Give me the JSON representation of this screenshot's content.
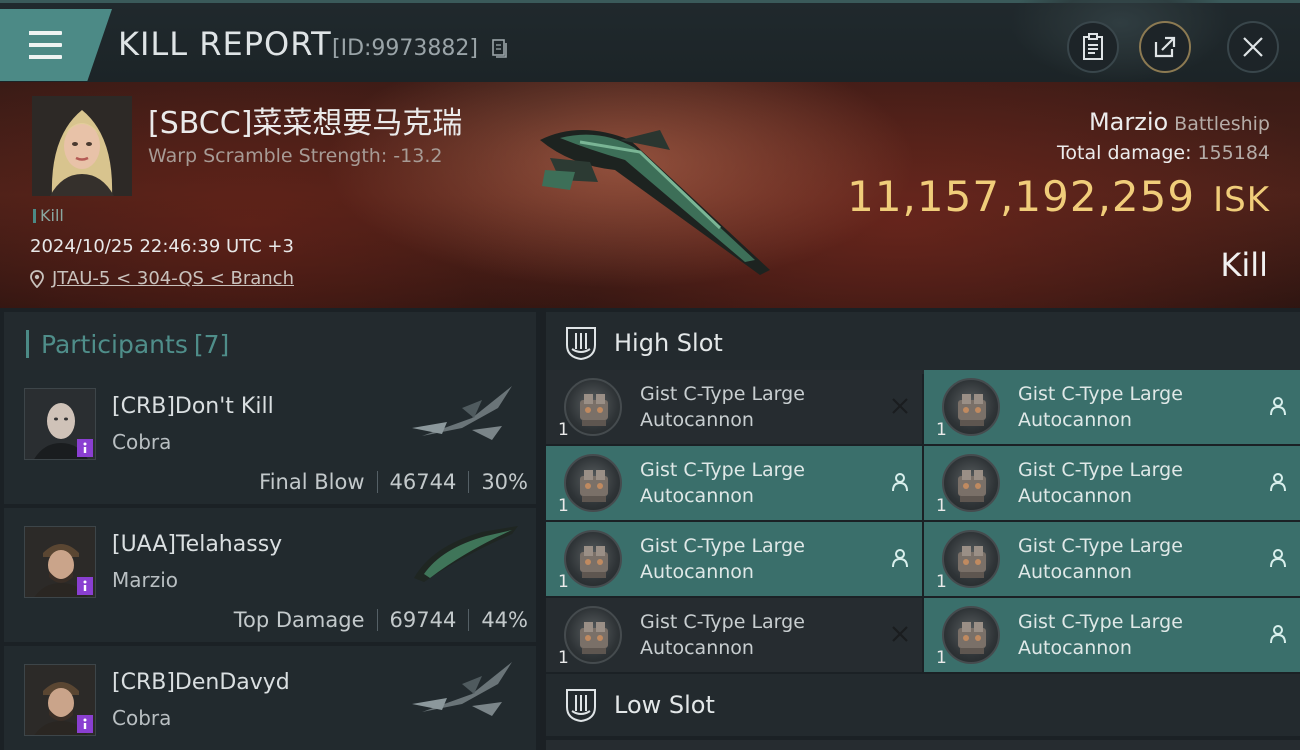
{
  "header": {
    "title": "KILL REPORT",
    "report_id": "[ID:9973882]"
  },
  "victim": {
    "pilot_name": "[SBCC]菜菜想要马克瑞",
    "warp_scramble": "Warp Scramble Strength: -13.2",
    "tag": "Kill",
    "timestamp": "2024/10/25 22:46:39 UTC +3",
    "location": "JTAU-5 < 304-QS < Branch",
    "ship_name": "Marzio",
    "ship_class": "Battleship",
    "total_damage_label": "Total damage:",
    "total_damage": "155184",
    "isk_value": "11,157,192,259",
    "isk_unit": "ISK",
    "result": "Kill"
  },
  "participants": {
    "label": "Participants",
    "count": "[7]",
    "rows": [
      {
        "name": "[CRB]Don't Kill",
        "ship": "Cobra",
        "role": "Final Blow",
        "damage": "46744",
        "percent": "30%"
      },
      {
        "name": "[UAA]Telahassy",
        "ship": "Marzio",
        "role": "Top Damage",
        "damage": "69744",
        "percent": "44%"
      },
      {
        "name": "[CRB]DenDavyd",
        "ship": "Cobra",
        "role": "",
        "damage": "",
        "percent": ""
      }
    ]
  },
  "slots": {
    "high_slot_label": "High Slot",
    "low_slot_label": "Low Slot",
    "high_modules": [
      {
        "line1": "Gist C-Type Large",
        "line2": "Autocannon",
        "qty": "1",
        "status": "destroyed-icon",
        "style": "dark"
      },
      {
        "line1": "Gist C-Type Large",
        "line2": "Autocannon",
        "qty": "1",
        "status": "dropped-icon",
        "style": "teal"
      },
      {
        "line1": "Gist C-Type Large",
        "line2": "Autocannon",
        "qty": "1",
        "status": "dropped-icon",
        "style": "teal"
      },
      {
        "line1": "Gist C-Type Large",
        "line2": "Autocannon",
        "qty": "1",
        "status": "dropped-icon",
        "style": "teal"
      },
      {
        "line1": "Gist C-Type Large",
        "line2": "Autocannon",
        "qty": "1",
        "status": "dropped-icon",
        "style": "teal"
      },
      {
        "line1": "Gist C-Type Large",
        "line2": "Autocannon",
        "qty": "1",
        "status": "dropped-icon",
        "style": "teal"
      },
      {
        "line1": "Gist C-Type Large",
        "line2": "Autocannon",
        "qty": "1",
        "status": "destroyed-icon",
        "style": "dark"
      },
      {
        "line1": "Gist C-Type Large",
        "line2": "Autocannon",
        "qty": "1",
        "status": "dropped-icon",
        "style": "teal"
      }
    ]
  },
  "colors": {
    "accent_teal": "#4c8a86",
    "isk_gold": "#f0cd7a",
    "module_teal": "#3a6f6b"
  }
}
